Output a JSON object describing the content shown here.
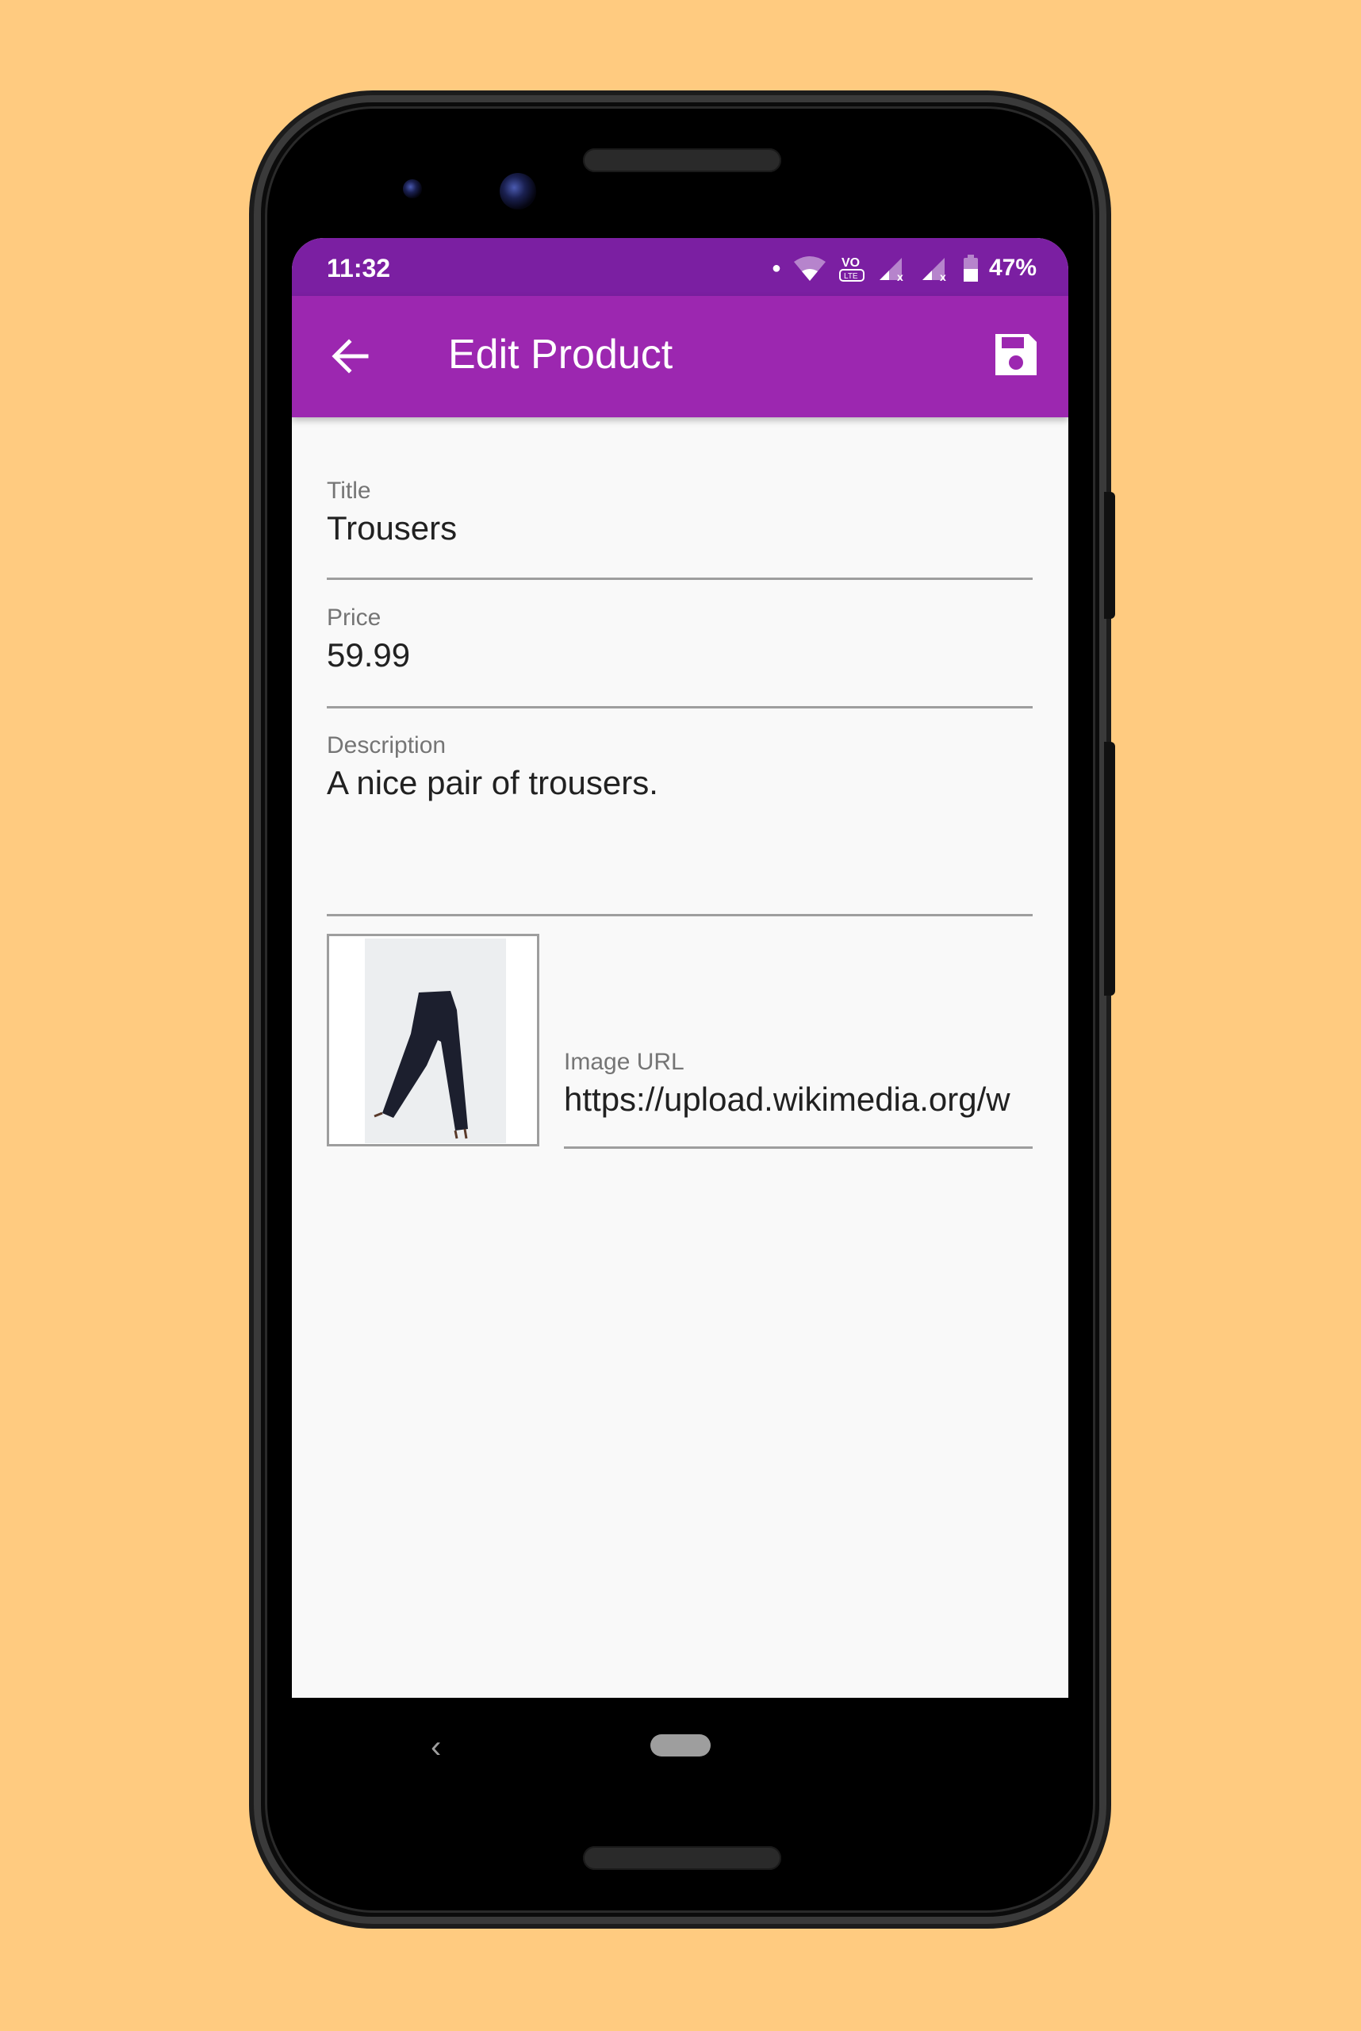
{
  "status_bar": {
    "time": "11:32",
    "battery": "47%",
    "icons": [
      "notification-dot-icon",
      "wifi-icon",
      "volte-icon",
      "signal-x-icon",
      "signal-x-icon",
      "battery-icon"
    ]
  },
  "toolbar": {
    "title": "Edit Product",
    "back_icon": "arrow-left-icon",
    "save_icon": "floppy-disk-icon"
  },
  "form": {
    "title": {
      "label": "Title",
      "value": "Trousers"
    },
    "price": {
      "label": "Price",
      "value": "59.99"
    },
    "description": {
      "label": "Description",
      "value": "A nice pair of trousers."
    },
    "image_url": {
      "label": "Image URL",
      "value": "https://upload.wikimedia.org/w"
    }
  },
  "preview": {
    "alt": "Trousers image preview"
  },
  "colors": {
    "background": "#ffcb80",
    "status_bar": "#7b1fa2",
    "toolbar": "#9c27b0",
    "screen_bg": "#f9f9f9"
  }
}
